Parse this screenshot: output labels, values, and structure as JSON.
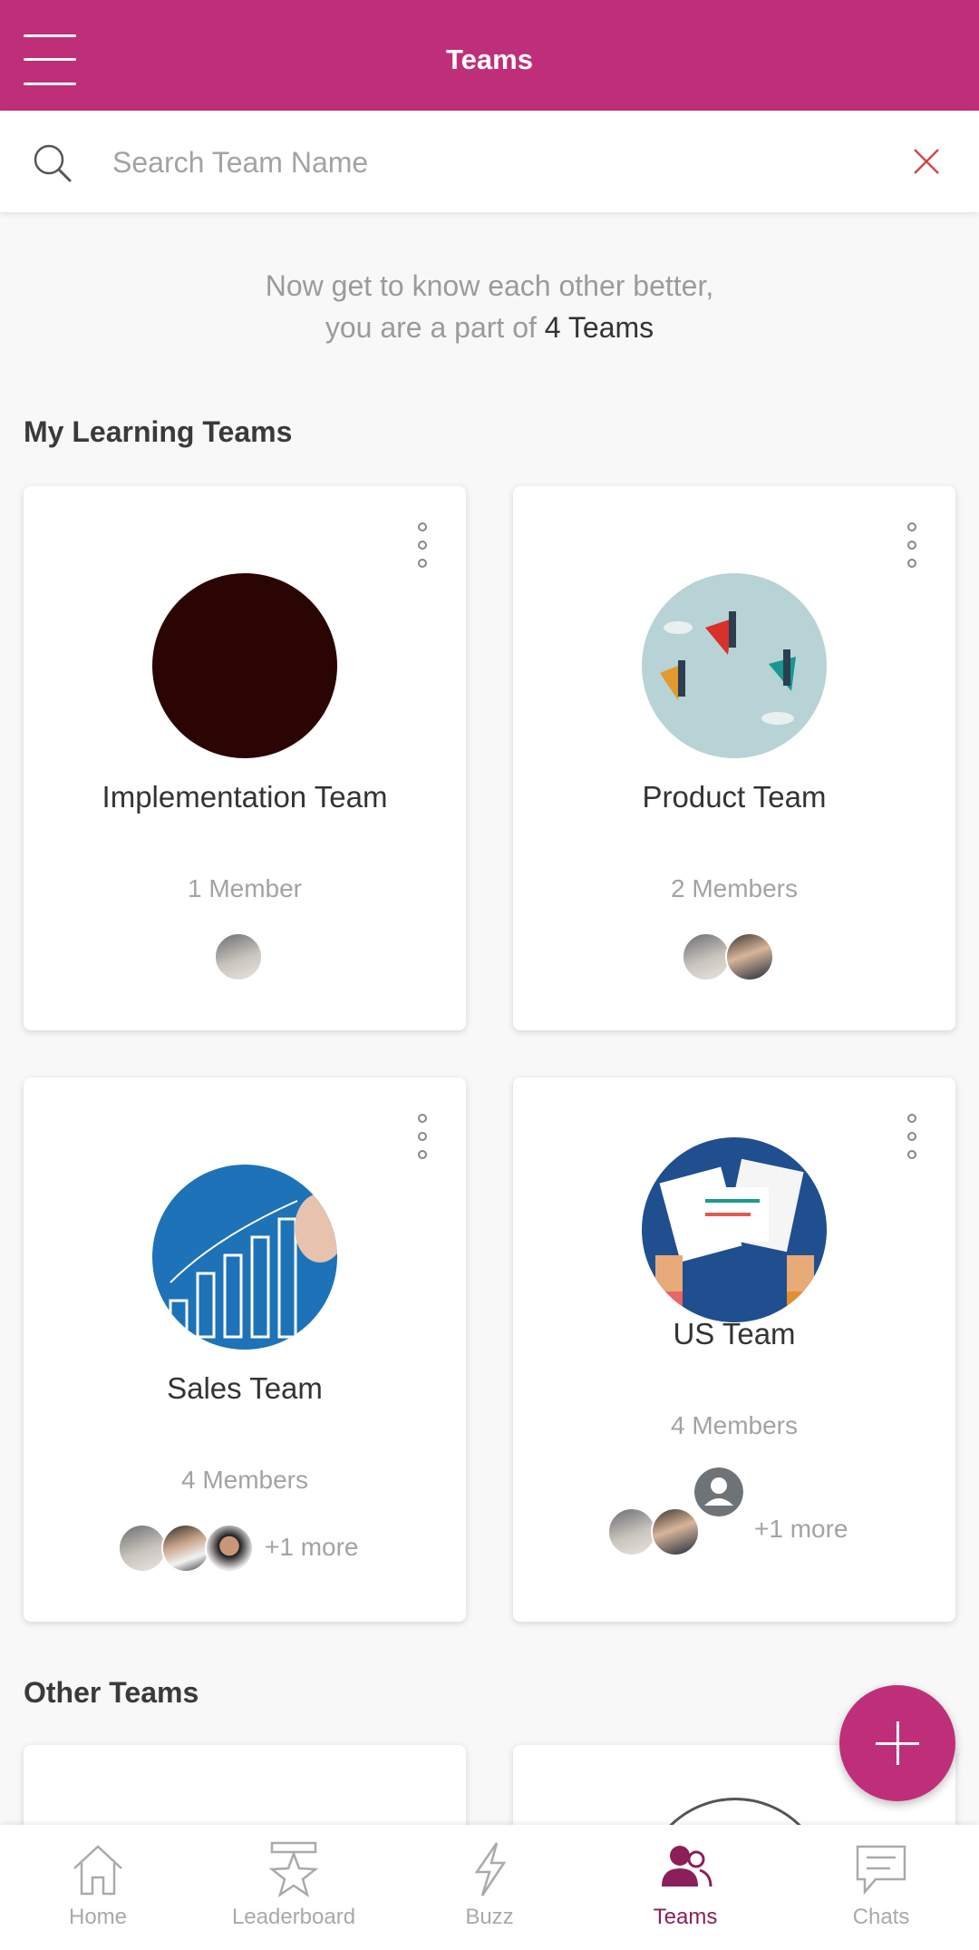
{
  "header": {
    "title": "Teams",
    "menu_icon": "hamburger-menu-icon",
    "brand_color": "#bf2f79"
  },
  "search": {
    "placeholder": "Search Team Name",
    "value": ""
  },
  "intro": {
    "line1": "Now get to know each other better,",
    "line2_prefix": "you are a part of ",
    "line2_count": "4 Teams"
  },
  "sections": {
    "my_teams": "My Learning Teams",
    "other_teams": "Other Teams"
  },
  "teams": [
    {
      "name": "Implementation Team",
      "members": "1 Member",
      "more": ""
    },
    {
      "name": "Product Team",
      "members": "2 Members",
      "more": ""
    },
    {
      "name": "Sales Team",
      "members": "4 Members",
      "more": "+1 more"
    },
    {
      "name": "US Team",
      "members": "4 Members",
      "more": "+1 more"
    }
  ],
  "nav": [
    {
      "label": "Home",
      "icon": "home-icon"
    },
    {
      "label": "Leaderboard",
      "icon": "star-icon"
    },
    {
      "label": "Buzz",
      "icon": "lightning-icon"
    },
    {
      "label": "Teams",
      "icon": "people-icon",
      "active": true
    },
    {
      "label": "Chats",
      "icon": "chat-icon"
    }
  ]
}
